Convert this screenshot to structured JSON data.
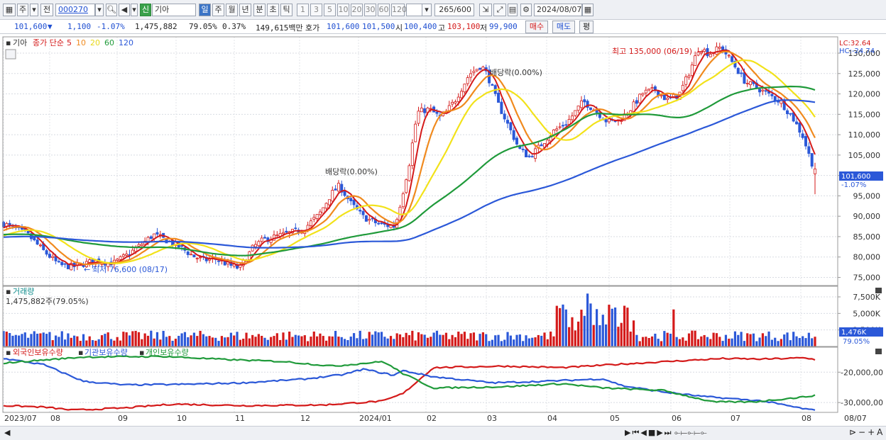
{
  "toolbar": {
    "period_left": "주",
    "prev_label": "전",
    "code": "000270",
    "stock_name": "기아",
    "new_badge": "신",
    "periods": [
      "일",
      "주",
      "월",
      "년",
      "분",
      "초",
      "틱"
    ],
    "active_period": "일",
    "intervals": [
      "1",
      "3",
      "5",
      "10",
      "20",
      "30",
      "60",
      "120"
    ],
    "count": "265",
    "total": "/600",
    "date": "2024/08/07"
  },
  "infobar": {
    "price": "101,600",
    "change": "1,100",
    "change_pct": "-1.07%",
    "volume": "1,475,882",
    "vol_ratio": "79.05%",
    "turnover_rate": "0.37%",
    "amount": "149,615백만",
    "ask_label": "호가",
    "ask1": "101,600",
    "ask2": "101,500",
    "open_label": "시",
    "open": "100,400",
    "high_label": "고",
    "high": "103,100",
    "low_label": "저",
    "low": "99,900",
    "buy_label": "매수",
    "sell_label": "매도",
    "avg_label": "평"
  },
  "price_pane": {
    "title": "기아",
    "legend": "종가 단순",
    "ma": [
      "5",
      "10",
      "20",
      "60",
      "120"
    ],
    "ma_colors": [
      "#d41a1a",
      "#f08a1e",
      "#f2e21a",
      "#1f9a3a",
      "#2b58d8"
    ],
    "lc": "LC:32.64",
    "hc": "HC:-24.74",
    "high_note": "최고 135,000 (06/19)",
    "low_note": "최저 76,600 (08/17)",
    "div1": "배당락(0.00%)",
    "div2": "배당락(0.00%)",
    "yticks": [
      "130,000",
      "125,000",
      "120,000",
      "115,000",
      "110,000",
      "105,000",
      "100,000",
      "95,000",
      "90,000",
      "85,000",
      "80,000",
      "75,000"
    ],
    "last_price": "101,600",
    "last_change": "-1.07%"
  },
  "volume_pane": {
    "title": "거래량",
    "current": "1,475,882주(79.05%)",
    "yticks": [
      "7,500K",
      "5,000K",
      "2,500K"
    ],
    "last_vol": "1,476K",
    "last_pct": "79.05%"
  },
  "holding_pane": {
    "legends": [
      "외국인보유수량",
      "기관보유수량",
      "개인보유수량"
    ],
    "legend_colors": [
      "#d41a1a",
      "#2b58d8",
      "#1f9a3a"
    ],
    "yticks": [
      "-20,000,00",
      "-30,000,00"
    ]
  },
  "xaxis": [
    "2023/07",
    "08",
    "09",
    "10",
    "11",
    "12",
    "2024/01",
    "02",
    "03",
    "04",
    "05",
    "06",
    "07",
    "08",
    "08/07"
  ],
  "chart_data": {
    "type": "candlestick",
    "high": {
      "value": 135000,
      "date": "06/19"
    },
    "low": {
      "value": 76600,
      "date": "08/17"
    },
    "last_close": 101600,
    "ylim": [
      73000,
      134000
    ],
    "volume_ticks_k": [
      2500,
      5000,
      7500
    ]
  }
}
